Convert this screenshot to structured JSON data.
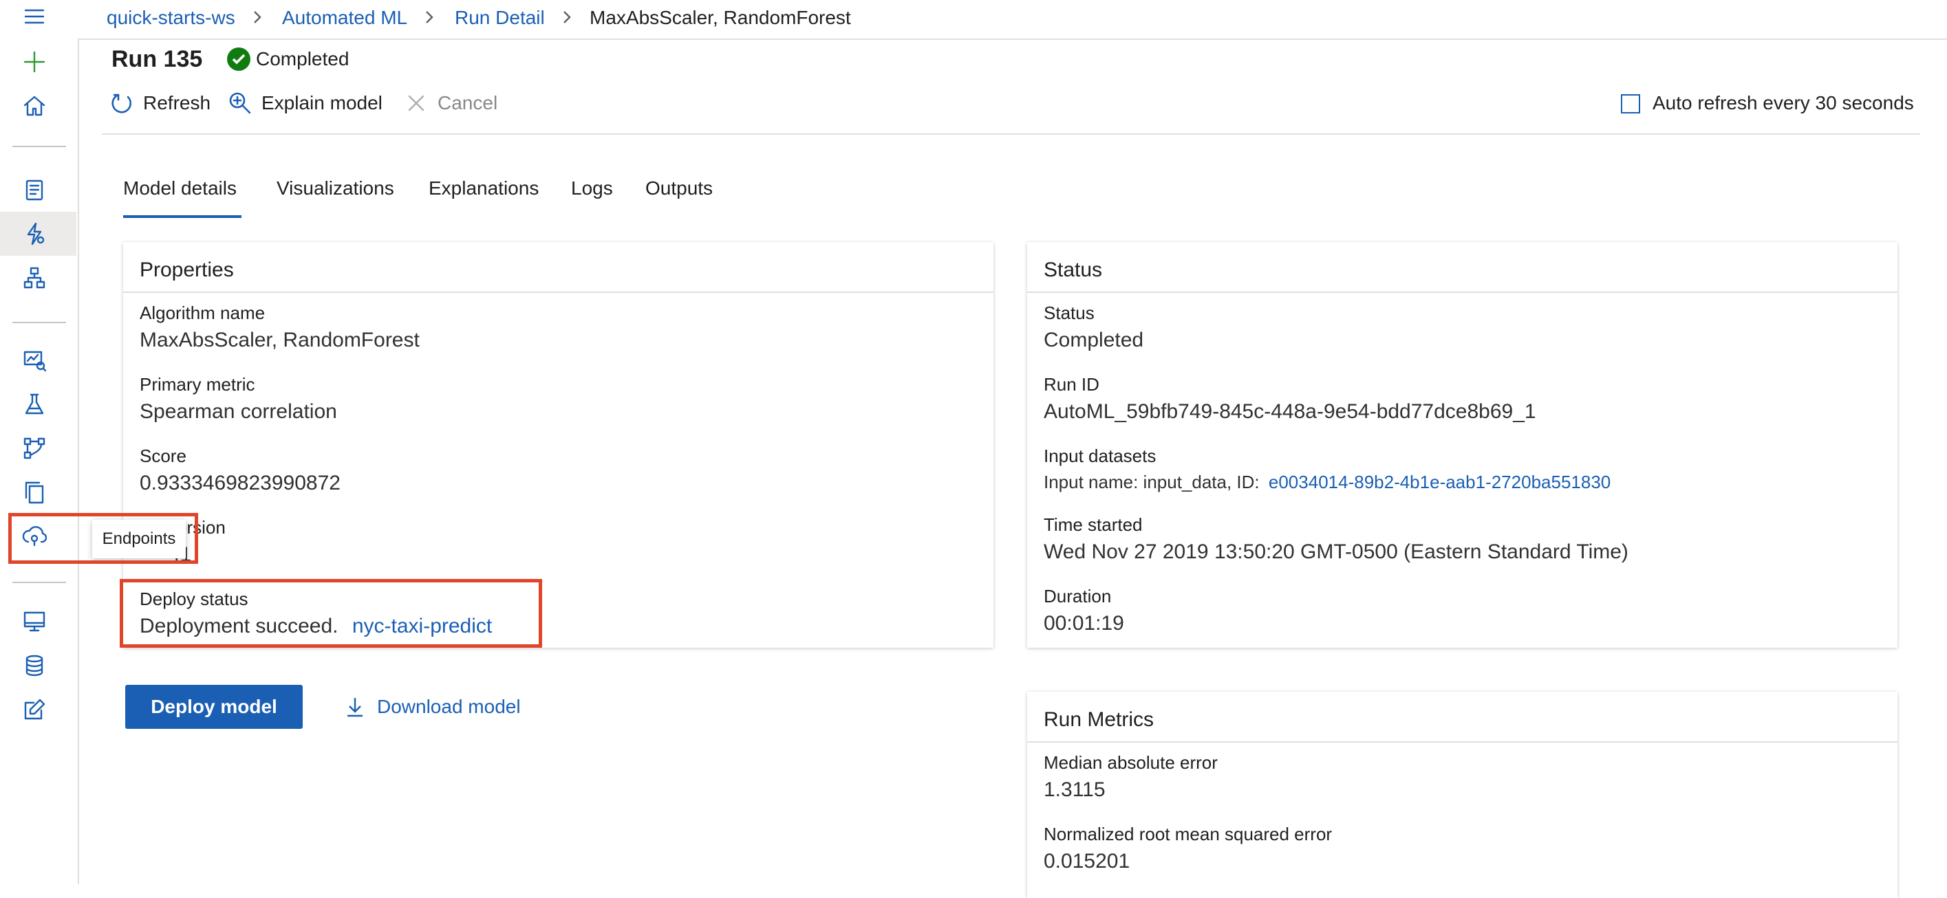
{
  "breadcrumb": {
    "items": [
      "quick-starts-ws",
      "Automated ML",
      "Run Detail",
      "MaxAbsScaler, RandomForest"
    ]
  },
  "header": {
    "title": "Run 135",
    "status": "Completed"
  },
  "toolbar": {
    "refresh": "Refresh",
    "explain": "Explain model",
    "cancel": "Cancel",
    "auto_refresh": "Auto refresh every 30 seconds",
    "auto_refresh_checked": false
  },
  "tabs": [
    "Model details",
    "Visualizations",
    "Explanations",
    "Logs",
    "Outputs"
  ],
  "active_tab": "Model details",
  "properties": {
    "title": "Properties",
    "algorithm_label": "Algorithm name",
    "algorithm_value": "MaxAbsScaler, RandomForest",
    "metric_label": "Primary metric",
    "metric_value": "Spearman correlation",
    "score_label": "Score",
    "score_value": "0.9333469823990872",
    "version_label": "ersion",
    "version_value": "41",
    "deploy_label": "Deploy status",
    "deploy_value": "Deployment succeed.",
    "deploy_link": "nyc-taxi-predict"
  },
  "status_card": {
    "title": "Status",
    "status_label": "Status",
    "status_value": "Completed",
    "runid_label": "Run ID",
    "runid_value": "AutoML_59bfb749-845c-448a-9e54-bdd77dce8b69_1",
    "datasets_label": "Input datasets",
    "datasets_prefix": "Input name: input_data, ID:",
    "datasets_link": "e0034014-89b2-4b1e-aab1-2720ba551830",
    "started_label": "Time started",
    "started_value": "Wed Nov 27 2019 13:50:20 GMT-0500 (Eastern Standard Time)",
    "duration_label": "Duration",
    "duration_value": "00:01:19"
  },
  "metrics_card": {
    "title": "Run Metrics",
    "mae_label": "Median absolute error",
    "mae_value": "1.3115",
    "nrmse_label": "Normalized root mean squared error",
    "nrmse_value": "0.015201"
  },
  "actions": {
    "deploy": "Deploy model",
    "download": "Download model"
  },
  "tooltip": "Endpoints",
  "colors": {
    "accent": "#1a5fb4",
    "success": "#107c10",
    "highlight": "#e0452a"
  },
  "nav_icons": [
    "hamburger-icon",
    "plus-icon",
    "home-icon",
    "notebook-icon",
    "automl-icon",
    "designer-icon",
    "datasets-icon",
    "experiments-icon",
    "pipelines-icon",
    "models-icon",
    "endpoints-icon",
    "compute-icon",
    "datastores-icon",
    "labeling-icon"
  ]
}
